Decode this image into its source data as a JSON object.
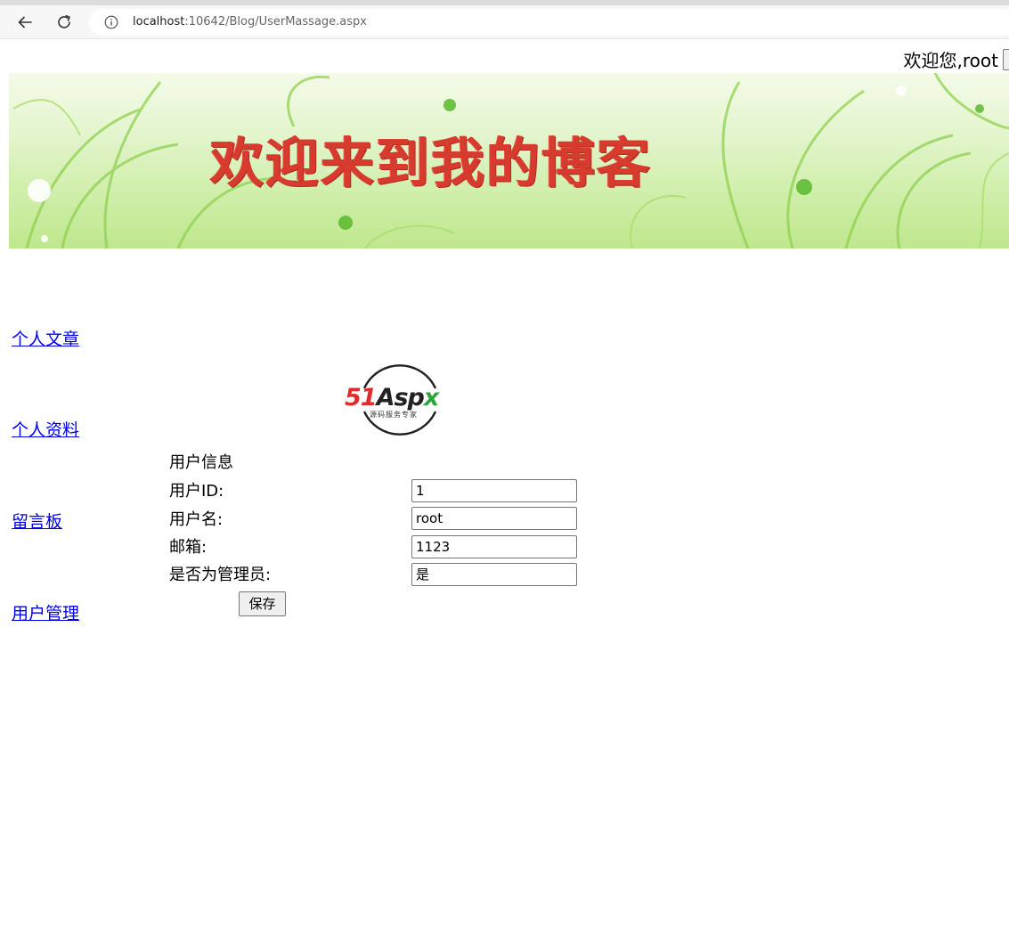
{
  "browser": {
    "url_host": "localhost",
    "url_rest": ":10642/Blog/UserMassage.aspx",
    "icons": [
      "back-arrow-icon",
      "reload-icon",
      "info-icon"
    ]
  },
  "header": {
    "welcome_text": "欢迎您,root"
  },
  "banner": {
    "title": "欢迎来到我的博客",
    "title_color": "#d63b2e",
    "background_color": "#c9ec9f"
  },
  "sidebar": {
    "items": [
      {
        "label": "个人文章"
      },
      {
        "label": "个人资料"
      },
      {
        "label": "留言板"
      },
      {
        "label": "用户管理"
      }
    ],
    "link_color": "#0000ee"
  },
  "logo": {
    "brand_num": "51",
    "brand_a": "Asp",
    "brand_x": "x",
    "tagline": "源码服务专家"
  },
  "form": {
    "title": "用户信息",
    "fields": [
      {
        "label": "用户ID:",
        "value": "1"
      },
      {
        "label": "用户名:",
        "value": "root"
      },
      {
        "label": "邮箱:",
        "value": "1123"
      },
      {
        "label": "是否为管理员:",
        "value": "是"
      }
    ],
    "save_label": "保存"
  }
}
